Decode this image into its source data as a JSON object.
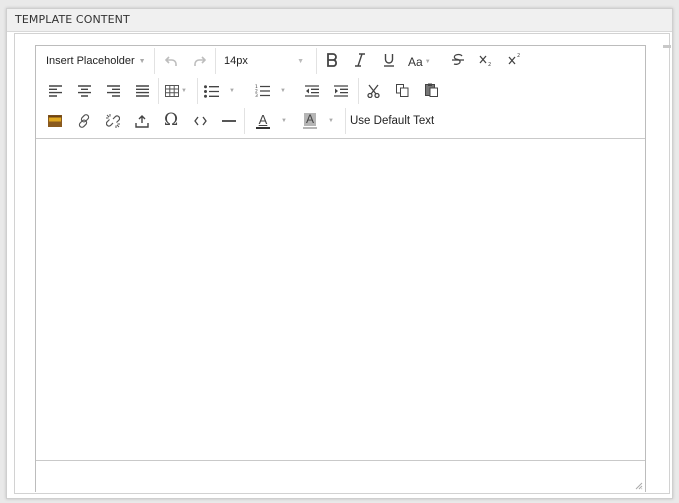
{
  "panel": {
    "title": "TEMPLATE CONTENT"
  },
  "toolbar": {
    "placeholder_dropdown": "Insert Placeholder",
    "font_size": "14px",
    "font_case_label": "Aa",
    "default_text_button": "Use Default Text",
    "text_color_letter": "A",
    "bg_color_letter": "A"
  },
  "icons": {
    "row1": [
      "undo-icon",
      "redo-icon",
      "bold-icon",
      "italic-icon",
      "underline-icon",
      "change-case-icon",
      "strikethrough-icon",
      "subscript-icon",
      "superscript-icon"
    ],
    "row2": [
      "align-left-icon",
      "align-center-icon",
      "align-right-icon",
      "justify-icon",
      "table-icon",
      "bullet-list-icon",
      "numbered-list-icon",
      "outdent-icon",
      "indent-icon",
      "cut-icon",
      "copy-icon",
      "paste-icon"
    ],
    "row3": [
      "image-icon",
      "link-icon",
      "unlink-icon",
      "insert-file-icon",
      "special-char-icon",
      "html-source-icon",
      "horizontal-rule-icon",
      "font-color-icon",
      "background-color-icon"
    ]
  },
  "colors": {
    "font_color_swatch": "#333333",
    "background_color_swatch": "#b5b5b5",
    "image_icon_brown": "#8a5a1e",
    "image_icon_gold": "#e0a820"
  }
}
